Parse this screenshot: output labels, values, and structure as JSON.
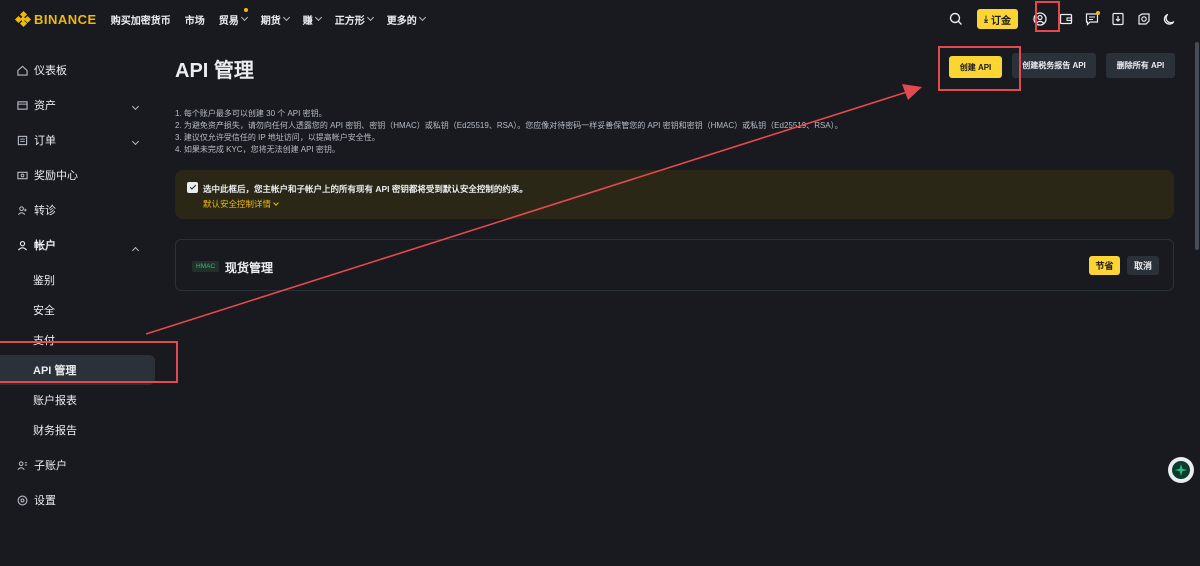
{
  "brand": {
    "name": "BINANCE",
    "color": "#f0b90b"
  },
  "nav": {
    "items": [
      {
        "label": "购买加密货币",
        "chevron": false,
        "dot": false
      },
      {
        "label": "市场",
        "chevron": false,
        "dot": false
      },
      {
        "label": "贸易",
        "chevron": true,
        "dot": true
      },
      {
        "label": "期货",
        "chevron": true,
        "dot": false
      },
      {
        "label": "赚",
        "chevron": true,
        "dot": false
      },
      {
        "label": "正方形",
        "chevron": true,
        "dot": false
      },
      {
        "label": "更多的",
        "chevron": true,
        "dot": false
      }
    ],
    "deposit_label": "订金",
    "icons": [
      "search-icon",
      "download-icon",
      "user-profile-icon",
      "wallet-icon",
      "message-icon",
      "app-download-icon",
      "language-icon",
      "theme-moon-icon"
    ]
  },
  "sidebar": {
    "items": [
      {
        "label": "仪表板",
        "icon": "dashboard-icon",
        "arrow": ""
      },
      {
        "label": "资产",
        "icon": "wallet-icon",
        "arrow": "down"
      },
      {
        "label": "订单",
        "icon": "orders-icon",
        "arrow": "down"
      },
      {
        "label": "奖励中心",
        "icon": "rewards-icon",
        "arrow": ""
      },
      {
        "label": "转诊",
        "icon": "referral-icon",
        "arrow": ""
      },
      {
        "label": "帐户",
        "icon": "account-icon",
        "arrow": "up",
        "bold": true
      }
    ],
    "account_sub": [
      "鉴别",
      "安全",
      "支付",
      "API 管理",
      "账户报表",
      "财务报告"
    ],
    "active_sub": "API 管理",
    "tail_items": [
      {
        "label": "子账户",
        "icon": "sub-account-icon"
      },
      {
        "label": "设置",
        "icon": "settings-icon"
      }
    ]
  },
  "main": {
    "title": "API 管理",
    "buttons": {
      "create_api": "创建 API",
      "create_tax_api": "创建税务报告 API",
      "delete_all_api": "删除所有 API"
    },
    "notes": [
      "1. 每个账户最多可以创建 30 个 API 密钥。",
      "2. 为避免资产损失，请勿向任何人透露您的 API 密钥、密钥（HMAC）或私钥（Ed25519、RSA）。您应像对待密码一样妥善保管您的 API 密钥和密钥（HMAC）或私钥（Ed25519、RSA）。",
      "3. 建议仅允许受信任的 IP 地址访问，以提高帐户安全性。",
      "4. 如果未完成 KYC，您将无法创建 API 密钥。"
    ],
    "alert": {
      "checked": true,
      "text": "选中此框后，您主帐户和子帐户上的所有现有 API 密钥都将受到默认安全控制的约束。",
      "link": "默认安全控制详情"
    },
    "card": {
      "badge": "HMAC",
      "title": "现货管理",
      "save_label": "节省",
      "cancel_label": "取消"
    }
  },
  "colors": {
    "background": "#181a20",
    "accent": "#fcd535",
    "annotation": "#e5484d"
  }
}
